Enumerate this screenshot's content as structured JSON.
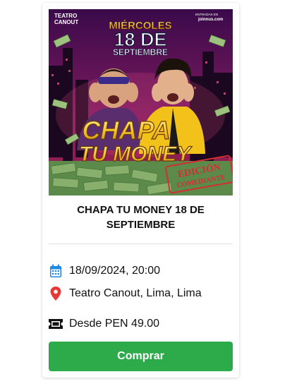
{
  "event": {
    "title": "CHAPA TU MONEY 18 DE SEPTIEMBRE",
    "date": "18/09/2024, 20:00",
    "venue": "Teatro Canout, Lima, Lima",
    "price": "Desde PEN 49.00",
    "buy_label": "Comprar"
  },
  "poster": {
    "logo_line1": "TEATRO",
    "logo_line2": "CANOUT",
    "ticket_brand_small": "ENTRADAS EN",
    "ticket_brand": "joinnus.com",
    "day": "MIÉRCOLES",
    "date_big": "18 DE",
    "month": "SEPTIEMBRE",
    "show_line1": "CHAPA",
    "show_line2": "TU MONEY",
    "stamp_line1": "EDICIÓN",
    "stamp_line2": "COMEDIANTE"
  },
  "colors": {
    "date_icon": "#1e88e5",
    "venue_icon": "#e53935",
    "button": "#2daa4a"
  },
  "icons": [
    "calendar-icon",
    "location-pin-icon",
    "ticket-icon"
  ]
}
